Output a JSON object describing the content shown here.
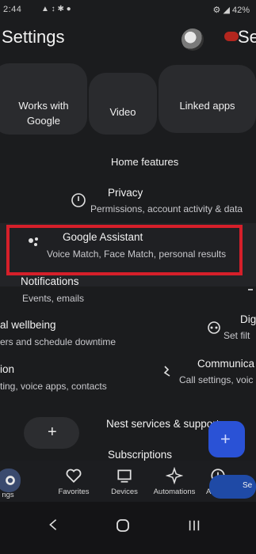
{
  "status_bar": {
    "time": "2:44",
    "indicators": "▲ ↕ ✱ ●",
    "right": "⚙ ◢ 42%"
  },
  "header": {
    "title": "Settings",
    "overlay_title": "Se"
  },
  "cards": [
    {
      "label": "Works with\nGoogle"
    },
    {
      "label": "Video"
    },
    {
      "label": "Linked apps"
    }
  ],
  "home_features": "Home features",
  "privacy": {
    "title": "Privacy",
    "subtitle": "Permissions, account activity & data"
  },
  "assistant": {
    "title": "Google Assistant",
    "subtitle": "Voice Match, Face Match, personal results"
  },
  "notifications": {
    "title": "Notifications",
    "subtitle": "Events, emails"
  },
  "wellbeing_left": {
    "title": "al wellbeing",
    "subtitle": "ers and schedule downtime"
  },
  "wellbeing_right": {
    "title": "Dig",
    "subtitle": "Set filt"
  },
  "communication_left": {
    "title": "ion",
    "subtitle": "ting, voice apps, contacts"
  },
  "communication_right": {
    "title": "Communica",
    "subtitle": "Call settings, voic"
  },
  "nest": "Nest services & support",
  "subscriptions": "Subscriptions",
  "bottom_nav": {
    "left_label": "ngs",
    "favorites": "Favorites",
    "devices": "Devices",
    "automations": "Automations",
    "activity": "Activity",
    "settings_right": "Se"
  }
}
